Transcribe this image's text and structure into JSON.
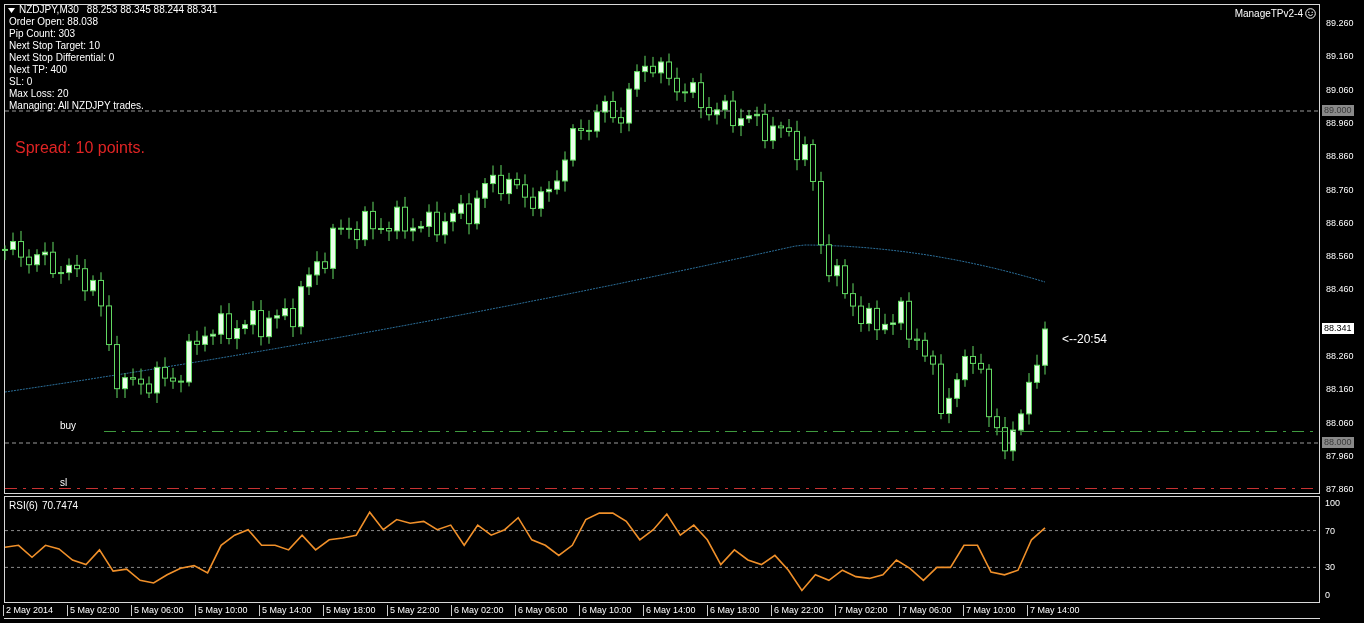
{
  "header": {
    "symbol": "NZDJPY,M30",
    "ohlc": "88.253 88.345 88.244 88.341"
  },
  "info_lines": [
    "Order Open: 88.038",
    "Pip Count: 303",
    "Next Stop Target: 10",
    "Next Stop Differential: 0",
    "Next TP: 400",
    "SL: 0",
    "Max Loss: 20",
    "Managing: All NZDJPY trades."
  ],
  "spread": "Spread: 10 points.",
  "expert": {
    "name": "ManageTPv2-4"
  },
  "price_axis": [
    "89.260",
    "89.160",
    "89.060",
    "88.960",
    "88.860",
    "88.760",
    "88.660",
    "88.560",
    "88.460",
    "88.260",
    "88.160",
    "88.060",
    "87.960",
    "87.860"
  ],
  "price_labels": [
    {
      "text": "89.000",
      "kind": "level"
    },
    {
      "text": "88.341",
      "kind": "bid"
    },
    {
      "text": "88.000",
      "kind": "level"
    }
  ],
  "order_lines": [
    {
      "label": "buy",
      "color": "#3f9a3f"
    },
    {
      "label": "sl",
      "color": "#c83232"
    }
  ],
  "timer": "<--20:54",
  "rsi": {
    "value": "70.7474",
    "chart_data": {
      "type": "line",
      "ylim": [
        -8.7,
        107.6
      ],
      "yticks": [
        0,
        30,
        70,
        100
      ],
      "series": [
        {
          "name": "RSI(6)",
          "color": "#f0902a",
          "values": [
            52,
            54,
            41,
            54,
            50,
            38,
            33,
            49,
            26,
            28,
            16,
            13,
            22,
            29,
            32,
            24,
            54,
            65,
            71,
            54,
            54,
            49,
            65,
            49,
            60,
            62,
            65,
            90,
            71,
            82,
            78,
            80,
            71,
            76,
            54,
            76,
            65,
            71,
            84,
            60,
            54,
            43,
            54,
            82,
            89,
            89,
            80,
            60,
            71,
            88,
            65,
            76,
            60,
            33,
            49,
            38,
            33,
            43,
            27,
            5,
            22,
            16,
            27,
            20,
            18,
            22,
            38,
            29,
            16,
            30,
            30,
            54,
            54,
            25,
            22,
            27,
            60,
            73
          ]
        }
      ]
    }
  },
  "time_axis": [
    "2 May 2014",
    "5 May 02:00",
    "5 May 06:00",
    "5 May 10:00",
    "5 May 14:00",
    "5 May 18:00",
    "5 May 22:00",
    "6 May 02:00",
    "6 May 06:00",
    "6 May 10:00",
    "6 May 14:00",
    "6 May 18:00",
    "6 May 22:00",
    "7 May 02:00",
    "7 May 06:00",
    "7 May 10:00",
    "7 May 14:00"
  ]
}
